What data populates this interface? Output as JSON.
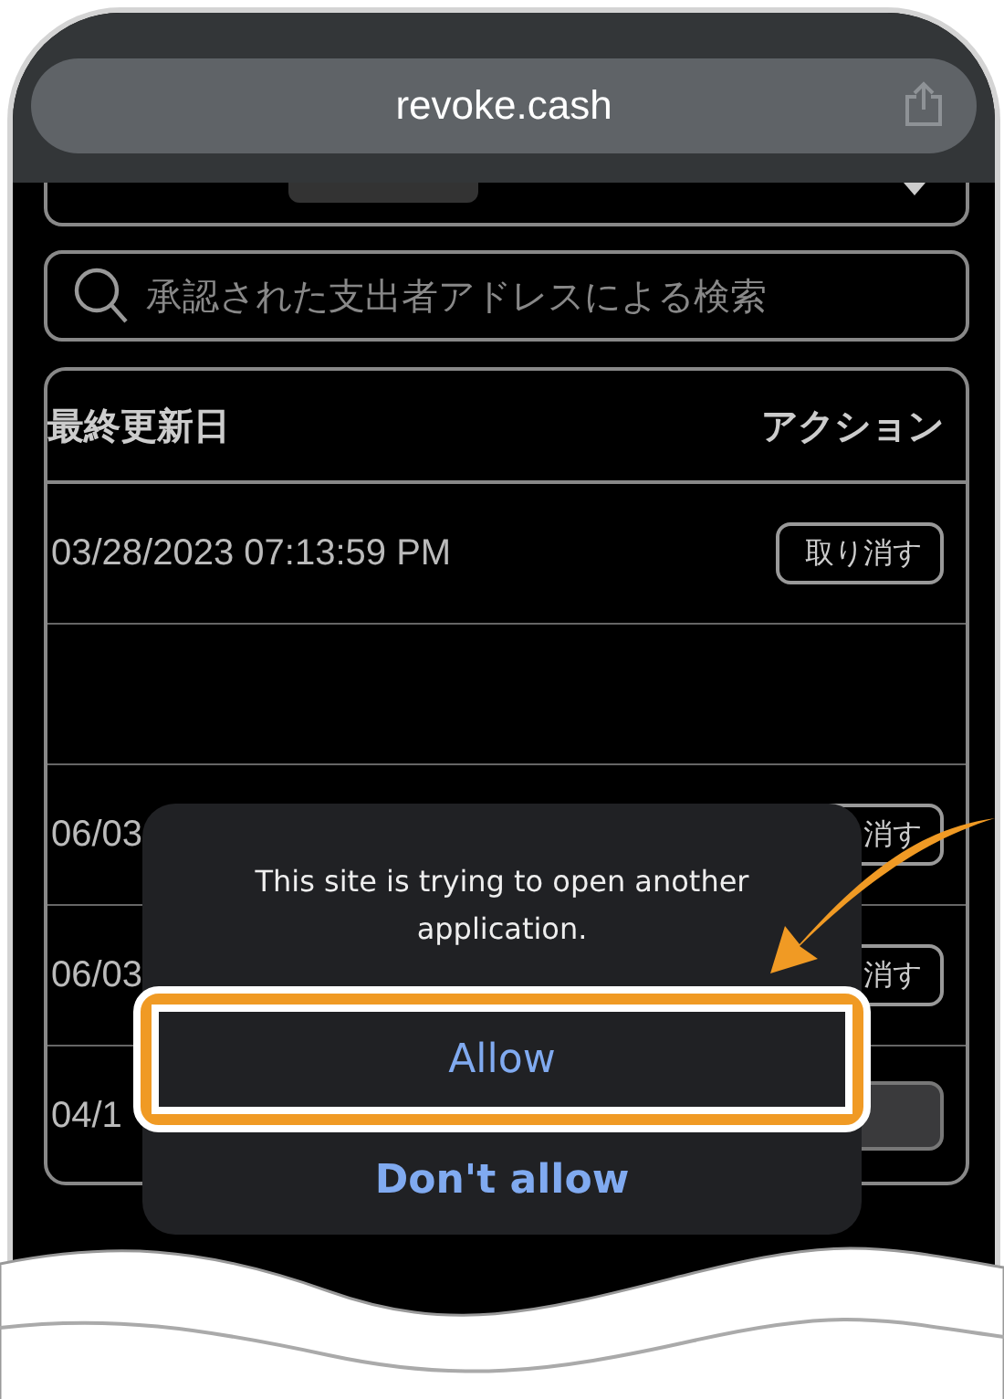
{
  "browser": {
    "address": "revoke.cash"
  },
  "search": {
    "placeholder": "承認された支出者アドレスによる検索"
  },
  "table": {
    "columns": [
      "最終更新日",
      "アクション"
    ],
    "rows": [
      {
        "kind": "entry",
        "date": "03/28/2023 07:13:59 PM",
        "action": "取り消す"
      },
      {
        "kind": "blank"
      },
      {
        "kind": "entry",
        "date": "06/03",
        "action": "消す"
      },
      {
        "kind": "entry",
        "date": "06/03",
        "action": "消す"
      },
      {
        "kind": "pending",
        "date": "04/1"
      }
    ]
  },
  "dialog": {
    "message": "This site is trying to open another application.",
    "buttons": [
      {
        "label": "Allow",
        "highlighted": true,
        "bold": false
      },
      {
        "label": "Don't allow",
        "highlighted": false,
        "bold": true
      }
    ]
  }
}
